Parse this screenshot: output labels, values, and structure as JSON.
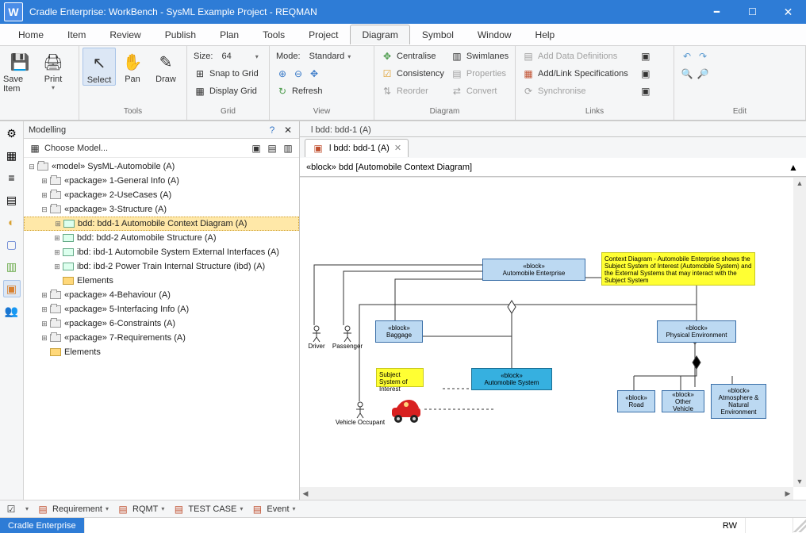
{
  "window": {
    "title": "Cradle Enterprise: WorkBench - SysML Example Project - REQMAN",
    "appLetter": "W"
  },
  "menu": {
    "items": [
      "Home",
      "Item",
      "Review",
      "Publish",
      "Plan",
      "Tools",
      "Project",
      "Diagram",
      "Symbol",
      "Window",
      "Help"
    ],
    "activeIndex": 7
  },
  "ribbon": {
    "toolsLabel": "Tools",
    "gridLabel": "Grid",
    "viewLabel": "View",
    "diagramLabel": "Diagram",
    "linksLabel": "Links",
    "editLabel": "Edit",
    "save": "Save Item",
    "print": "Print",
    "select": "Select",
    "pan": "Pan",
    "draw": "Draw",
    "sizeLabel": "Size:",
    "sizeValue": "64",
    "snap": "Snap to Grid",
    "display": "Display Grid",
    "modeLabel": "Mode:",
    "modeValue": "Standard",
    "refresh": "Refresh",
    "centralise": "Centralise",
    "swimlanes": "Swimlanes",
    "consistency": "Consistency",
    "properties": "Properties",
    "reorder": "Reorder",
    "convert": "Convert",
    "addDefs": "Add Data Definitions",
    "addSpecs": "Add/Link Specifications",
    "sync": "Synchronise"
  },
  "sidebar": {
    "title": "Modelling",
    "choose": "Choose Model...",
    "nodes": [
      {
        "d": 0,
        "tw": "-",
        "ic": "pkg",
        "label": "«model» SysML-Automobile (A)"
      },
      {
        "d": 1,
        "tw": "+",
        "ic": "pkg",
        "label": "«package» 1-General Info (A)"
      },
      {
        "d": 1,
        "tw": "+",
        "ic": "pkg",
        "label": "«package» 2-UseCases (A)"
      },
      {
        "d": 1,
        "tw": "-",
        "ic": "pkg",
        "label": "«package» 3-Structure (A)"
      },
      {
        "d": 2,
        "tw": "+",
        "ic": "bdd",
        "label": "bdd: bdd-1 Automobile Context Diagram (A)",
        "sel": true
      },
      {
        "d": 2,
        "tw": "+",
        "ic": "bdd",
        "label": "bdd: bdd-2 Automobile Structure (A)"
      },
      {
        "d": 2,
        "tw": "+",
        "ic": "bdd",
        "label": "ibd: ibd-1 Automobile System External Interfaces (A)"
      },
      {
        "d": 2,
        "tw": "+",
        "ic": "bdd",
        "label": "ibd: ibd-2 Power Train Internal Structure (ibd) (A)"
      },
      {
        "d": 2,
        "tw": "",
        "ic": "fold",
        "label": "Elements"
      },
      {
        "d": 1,
        "tw": "+",
        "ic": "pkg",
        "label": "«package» 4-Behaviour (A)"
      },
      {
        "d": 1,
        "tw": "+",
        "ic": "pkg",
        "label": "«package» 5-Interfacing Info (A)"
      },
      {
        "d": 1,
        "tw": "+",
        "ic": "pkg",
        "label": "«package» 6-Constraints (A)"
      },
      {
        "d": 1,
        "tw": "+",
        "ic": "pkg",
        "label": "«package» 7-Requirements (A)"
      },
      {
        "d": 1,
        "tw": "",
        "ic": "fold",
        "label": "Elements"
      }
    ]
  },
  "doc": {
    "outerTab": "l bdd: bdd-1 (A)",
    "tab": "l bdd: bdd-1 (A)",
    "title": "«block» bdd [Automobile Context Diagram]"
  },
  "diagram": {
    "blocks": {
      "enterprise": {
        "stereo": "«block»",
        "name": "Automobile Enterprise"
      },
      "baggage": {
        "stereo": "«block»",
        "name": "Baggage"
      },
      "physEnv": {
        "stereo": "«block»",
        "name": "Physical Environment"
      },
      "autoSys": {
        "stereo": "«block»",
        "name": "Automobile System"
      },
      "road": {
        "stereo": "«block»",
        "name": "Road"
      },
      "otherVeh": {
        "stereo": "«block»",
        "name": "Other Vehicle"
      },
      "atmos": {
        "stereo": "«block»",
        "name": "Atmosphere & Natural Environment"
      }
    },
    "actors": {
      "driver": "Driver",
      "passenger": "Passenger",
      "occupant": "Vehicle Occupant"
    },
    "notes": {
      "context": "Context Diagram - Automobile Enterprise shows the Subject System of Interest (Automobile System) and the External Systems that may interact with the Subject System",
      "subject": "Subject System of Interest"
    }
  },
  "footer": {
    "tabs": [
      "Requirement",
      "RQMT",
      "TEST CASE",
      "Event"
    ]
  },
  "status": {
    "brand": "Cradle Enterprise",
    "rw": "RW"
  }
}
